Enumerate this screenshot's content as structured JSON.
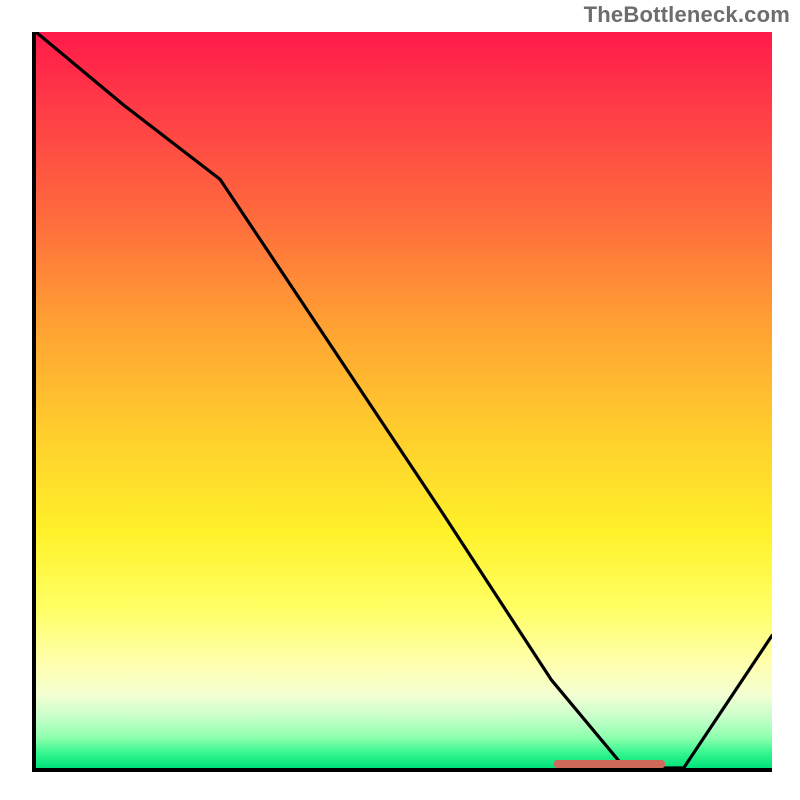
{
  "attribution": "TheBottleneck.com",
  "chart_data": {
    "type": "line",
    "title": "",
    "xlabel": "",
    "ylabel": "",
    "xlim": [
      0,
      100
    ],
    "ylim": [
      0,
      100
    ],
    "series": [
      {
        "name": "curve",
        "x": [
          0,
          12,
          25,
          55,
          70,
          80,
          88,
          100
        ],
        "y": [
          100,
          90,
          80,
          35,
          12,
          0,
          0,
          18
        ]
      }
    ],
    "highlight_band": {
      "x_start": 70,
      "x_end": 85,
      "y": 0
    },
    "gradient_stops": [
      {
        "pos": 0,
        "color": "#ff1a4a"
      },
      {
        "pos": 25,
        "color": "#ff6a3d"
      },
      {
        "pos": 55,
        "color": "#ffcf2c"
      },
      {
        "pos": 78,
        "color": "#ffff62"
      },
      {
        "pos": 93,
        "color": "#c9ffcb"
      },
      {
        "pos": 100,
        "color": "#00e27a"
      }
    ]
  }
}
